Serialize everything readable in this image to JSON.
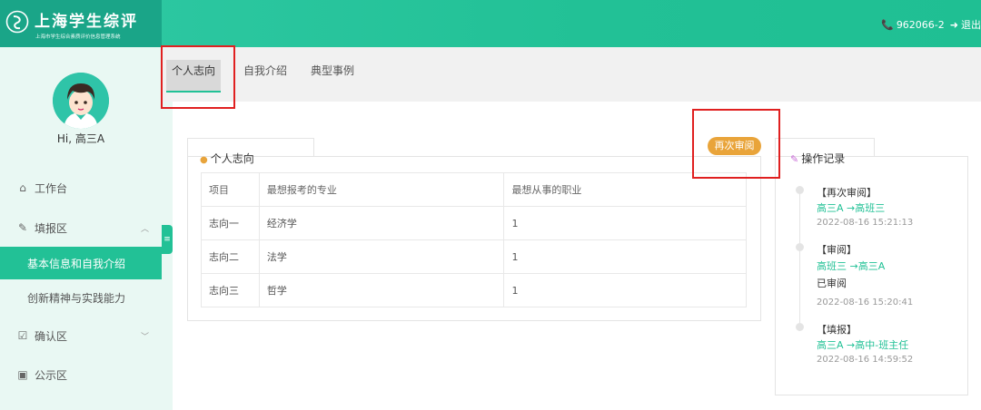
{
  "brand": {
    "title": "上海学生综评",
    "subtitle": "上海市学生综合素质评价信息管理系统"
  },
  "header": {
    "user_id": "962066-2",
    "logout_label": "退出"
  },
  "sidebar": {
    "greeting": "Hi, 高三A",
    "items": [
      {
        "label": "工作台",
        "icon": "home-icon"
      },
      {
        "label": "填报区",
        "icon": "edit-icon"
      },
      {
        "label": "基本信息和自我介绍"
      },
      {
        "label": "创新精神与实践能力"
      },
      {
        "label": "确认区",
        "icon": "checkbox-icon"
      },
      {
        "label": "公示区",
        "icon": "board-icon"
      }
    ]
  },
  "tabs": [
    {
      "label": "个人志向",
      "active": true
    },
    {
      "label": "自我介绍"
    },
    {
      "label": "典型事例"
    }
  ],
  "panel": {
    "title": "个人志向",
    "badge": "再次审阅",
    "columns": [
      "项目",
      "最想报考的专业",
      "最想从事的职业"
    ],
    "rows": [
      [
        "志向一",
        "经济学",
        "1"
      ],
      [
        "志向二",
        "法学",
        "1"
      ],
      [
        "志向三",
        "哲学",
        "1"
      ]
    ]
  },
  "records": {
    "title": "操作记录",
    "entries": [
      {
        "action": "【再次审阅】",
        "flow": "高三A →高班三",
        "note": "",
        "time": "2022-08-16 15:21:13"
      },
      {
        "action": "【审阅】",
        "flow": "高班三 →高三A",
        "note": "已审阅",
        "time": "2022-08-16 15:20:41"
      },
      {
        "action": "【填报】",
        "flow": "高三A →高中-班主任",
        "note": "",
        "time": "2022-08-16 14:59:52"
      }
    ]
  },
  "colors": {
    "accent": "#22c196",
    "badge": "#e9a43a",
    "highlight": "#e02020"
  }
}
